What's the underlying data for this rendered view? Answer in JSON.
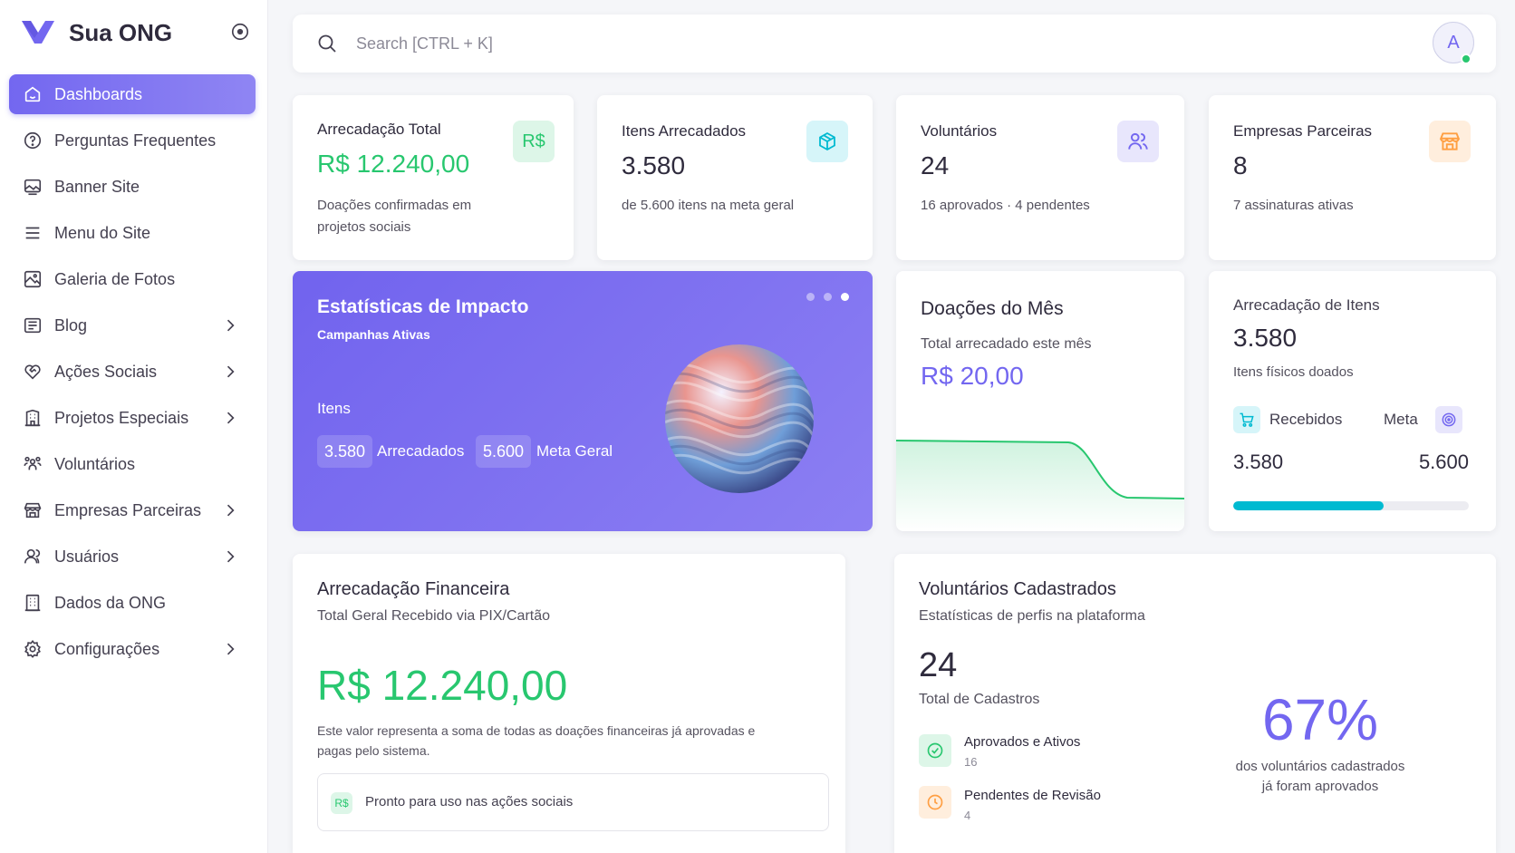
{
  "brand": {
    "name": "Sua ONG",
    "color": "#7367f0"
  },
  "sidebar": {
    "items": [
      {
        "label": "Dashboards",
        "icon": "home-icon",
        "active": true,
        "has_children": false
      },
      {
        "label": "Perguntas Frequentes",
        "icon": "help-circle-icon",
        "has_children": false
      },
      {
        "label": "Banner Site",
        "icon": "image-icon",
        "has_children": false
      },
      {
        "label": "Menu do Site",
        "icon": "menu-icon",
        "has_children": false
      },
      {
        "label": "Galeria de Fotos",
        "icon": "photo-icon",
        "has_children": false
      },
      {
        "label": "Blog",
        "icon": "article-icon",
        "has_children": true
      },
      {
        "label": "Ações Sociais",
        "icon": "heart-handshake-icon",
        "has_children": true
      },
      {
        "label": "Projetos Especiais",
        "icon": "building-icon",
        "has_children": true
      },
      {
        "label": "Voluntários",
        "icon": "users-group-icon",
        "has_children": false
      },
      {
        "label": "Empresas Parceiras",
        "icon": "store-icon",
        "has_children": true
      },
      {
        "label": "Usuários",
        "icon": "user-icon",
        "has_children": true
      },
      {
        "label": "Dados da ONG",
        "icon": "building-office-icon",
        "has_children": false
      },
      {
        "label": "Configurações",
        "icon": "settings-icon",
        "has_children": true
      }
    ]
  },
  "search": {
    "placeholder": "Search [CTRL + K]"
  },
  "user": {
    "initial": "A",
    "status_color": "#28c76f"
  },
  "stats": [
    {
      "title": "Arrecadação Total",
      "value": "R$ 12.240,00",
      "sub": "Doações confirmadas em projetos sociais",
      "badge": "R$"
    },
    {
      "title": "Itens Arrecadados",
      "value": "3.580",
      "sub": "de 5.600 itens na meta geral",
      "icon": "box-icon"
    },
    {
      "title": "Voluntários",
      "value": "24",
      "sub": "16 aprovados · 4 pendentes",
      "icon": "users-icon"
    },
    {
      "title": "Empresas Parceiras",
      "value": "8",
      "sub": "7 assinaturas ativas",
      "icon": "store-icon"
    }
  ],
  "impact": {
    "title": "Estatísticas de Impacto",
    "subtitle": "Campanhas Ativas",
    "section": "Itens",
    "collected_value": "3.580",
    "collected_label": "Arrecadados",
    "goal_value": "5.600",
    "goal_label": "Meta Geral",
    "slides": 3,
    "active_slide": 3
  },
  "monthly": {
    "title": "Doações do Mês",
    "label": "Total arrecadado este mês",
    "value": "R$ 20,00"
  },
  "items": {
    "title": "Arrecadação de Itens",
    "value": "3.580",
    "sub": "Itens físicos doados",
    "received_label": "Recebidos",
    "goal_label": "Meta",
    "received_value": "3.580",
    "goal_value": "5.600",
    "progress": 0.64
  },
  "financial": {
    "title": "Arrecadação Financeira",
    "subtitle": "Total Geral Recebido via PIX/Cartão",
    "value": "R$ 12.240,00",
    "description": "Este valor representa a soma de todas as doações financeiras já aprovadas e pagas pelo sistema.",
    "badge": "R$",
    "note": "Pronto para uso nas ações sociais"
  },
  "volunteers": {
    "title": "Voluntários Cadastrados",
    "subtitle": "Estatísticas de perfis na plataforma",
    "total": "24",
    "total_label": "Total de Cadastros",
    "approved_label": "Aprovados e Ativos",
    "approved_value": "16",
    "pending_label": "Pendentes de Revisão",
    "pending_value": "4",
    "percent": "67%",
    "percent_label_1": "dos voluntários cadastrados",
    "percent_label_2": "já foram aprovados"
  },
  "colors": {
    "primary": "#7367f0",
    "success": "#28c76f",
    "info": "#00bad1",
    "warning": "#ff9f43"
  }
}
